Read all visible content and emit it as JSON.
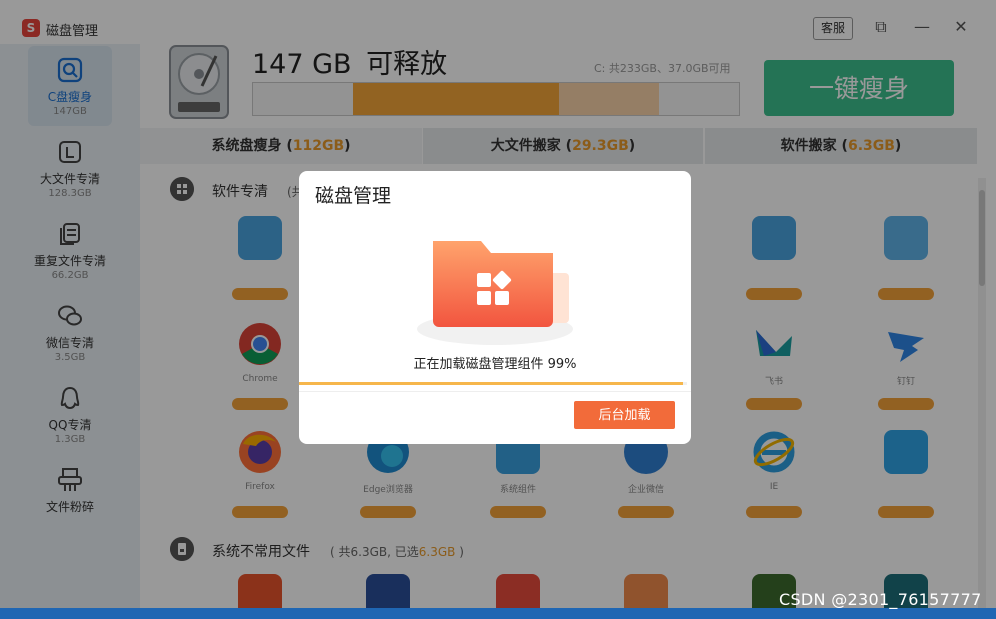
{
  "window": {
    "logo_text": "S",
    "title": "磁盘管理",
    "support_label": "客服",
    "pin_glyph": "⧉",
    "minimize_glyph": "—",
    "close_glyph": "✕"
  },
  "sidebar": {
    "items": [
      {
        "label": "C盘瘦身",
        "sub": "147GB",
        "icon": "disk-search-icon",
        "active": true
      },
      {
        "label": "大文件专清",
        "sub": "128.3GB",
        "icon": "large-file-icon"
      },
      {
        "label": "重复文件专清",
        "sub": "66.2GB",
        "icon": "duplicate-file-icon"
      },
      {
        "label": "微信专清",
        "sub": "3.5GB",
        "icon": "wechat-icon"
      },
      {
        "label": "QQ专清",
        "sub": "1.3GB",
        "icon": "qq-icon"
      },
      {
        "label": "文件粉碎",
        "sub": "",
        "icon": "shredder-icon"
      }
    ]
  },
  "header": {
    "free_amount": "147 GB",
    "free_label": "可释放",
    "disk_info": "C: 共233GB、37.0GB可用",
    "one_click_label": "一键瘦身"
  },
  "tabs": [
    {
      "label": "系统盘瘦身 (",
      "value": "112GB",
      "close": ")"
    },
    {
      "label": "大文件搬家 (",
      "value": "29.3GB",
      "close": ")"
    },
    {
      "label": "软件搬家 (",
      "value": "6.3GB",
      "close": ")"
    }
  ],
  "section1": {
    "title": "软件专清",
    "meta_prefix": "(共"
  },
  "apps_visible_labels": [
    "Chrome",
    "Firefox",
    "Edge浏览器",
    "系统组件",
    "企业微信",
    "飞书",
    "钉钉",
    "IE"
  ],
  "section2": {
    "title": "系统不常用文件",
    "meta_prefix": "( 共6.3GB, 已选",
    "meta_value": "6.3GB",
    "meta_suffix": " )"
  },
  "dialog": {
    "title": "磁盘管理",
    "status": "正在加载磁盘管理组件 99%",
    "progress": 0.99,
    "button_label": "后台加载"
  },
  "watermark": "CSDN @2301_76157777",
  "colors": {
    "accent_orange": "#f4a63a",
    "green": "#3cc08e",
    "button_orange": "#f26b3a"
  }
}
